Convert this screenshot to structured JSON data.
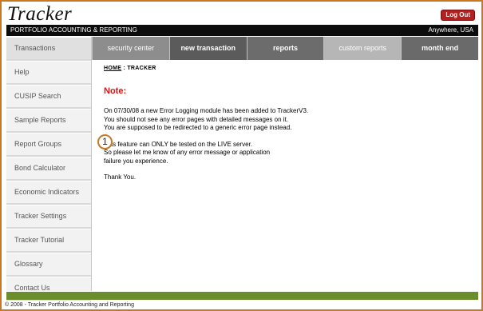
{
  "header": {
    "logo": "Tracker",
    "subtitle": "PORTFOLIO ACCOUNTING & REPORTING",
    "location": "Anywhere, USA",
    "logout_label": "Log Out"
  },
  "sidebar": {
    "items": [
      {
        "label": "Transactions"
      },
      {
        "label": "Help"
      },
      {
        "label": "CUSIP Search"
      },
      {
        "label": "Sample Reports"
      },
      {
        "label": "Report Groups"
      },
      {
        "label": "Bond Calculator"
      },
      {
        "label": "Economic Indicators"
      },
      {
        "label": "Tracker Settings"
      },
      {
        "label": "Tracker Tutorial"
      },
      {
        "label": "Glossary"
      },
      {
        "label": "Contact Us"
      }
    ]
  },
  "nav": {
    "tabs": [
      {
        "label": "security center"
      },
      {
        "label": "new transaction"
      },
      {
        "label": "reports"
      },
      {
        "label": "custom reports"
      },
      {
        "label": "month end"
      }
    ]
  },
  "content": {
    "breadcrumb_home": "HOME",
    "breadcrumb_sep": " : ",
    "breadcrumb_current": "TRACKER",
    "note_title": "Note:",
    "para1": [
      "On 07/30/08 a new Error Logging module has been added to TrackerV3.",
      "You should not see any error pages with detailed messages on it.",
      "You are supposed to be redirected to a generic error page instead."
    ],
    "para2": [
      "This feature can ONLY be tested on the LIVE server.",
      "So please let me know of any error message or application",
      "failure you experience."
    ],
    "thanks": "Thank You."
  },
  "marker": {
    "number": "1"
  },
  "footer": {
    "text": "© 2008 - Tracker Portfolio Accounting and Reporting"
  },
  "colors": {
    "frame": "#c9781f",
    "accent_green": "#6a8e2b",
    "logout": "#b41f1f",
    "note": "#e01010"
  }
}
